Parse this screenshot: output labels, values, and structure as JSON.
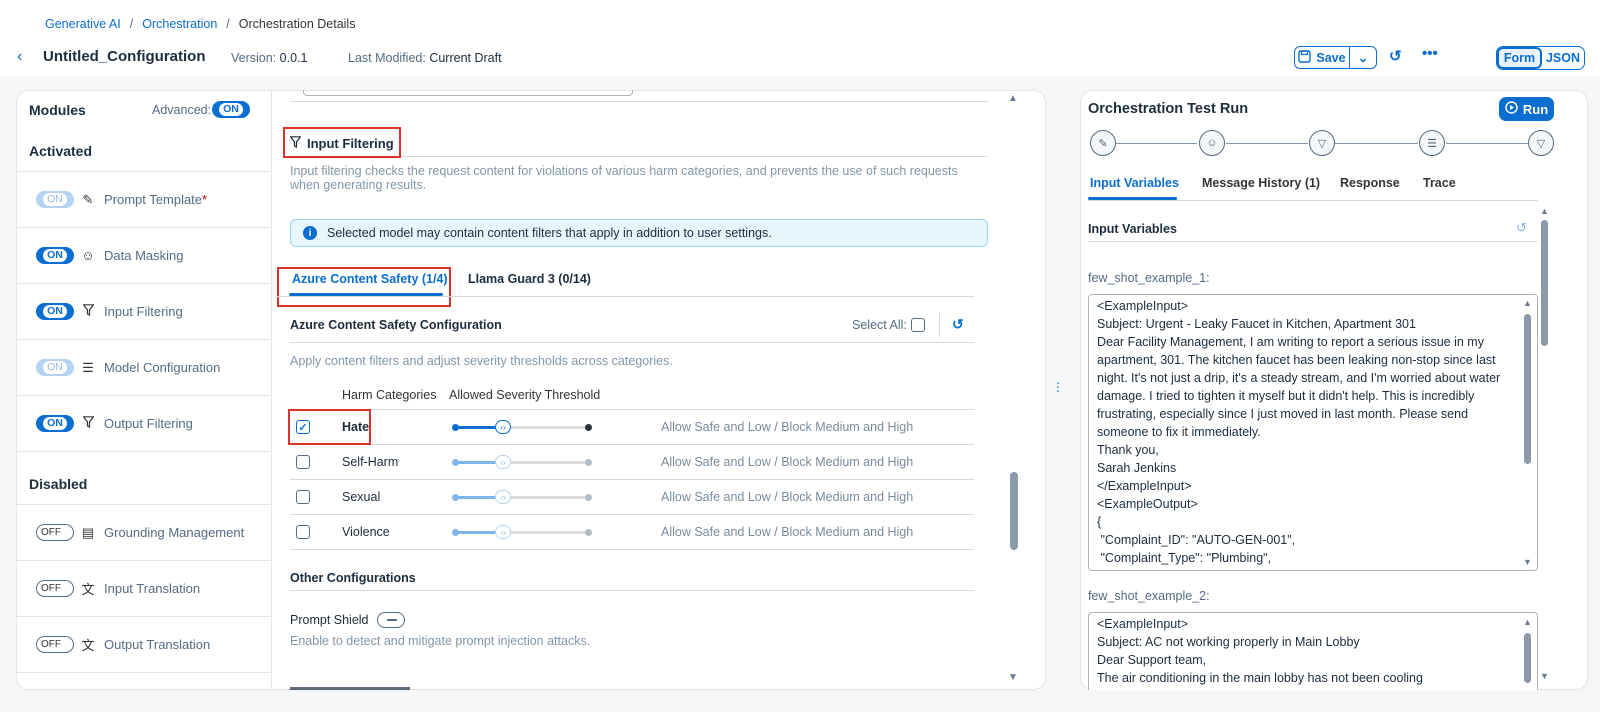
{
  "breadcrumb": [
    "Generative AI",
    "Orchestration",
    "Orchestration Details"
  ],
  "header": {
    "title": "Untitled_Configuration",
    "version_label": "Version:",
    "version": "0.0.1",
    "modified_label": "Last Modified:",
    "modified": "Current Draft",
    "save_label": "Save",
    "view_form": "Form",
    "view_json": "JSON"
  },
  "modules": {
    "title": "Modules",
    "advanced_label": "Advanced:",
    "advanced_toggle": "ON",
    "activated_heading": "Activated",
    "disabled_heading": "Disabled",
    "activated": [
      {
        "toggle": "ON",
        "label": "Prompt Template",
        "required": "*",
        "icon": "prompt-template-icon"
      },
      {
        "toggle": "ON",
        "label": "Data Masking",
        "icon": "mask-icon"
      },
      {
        "toggle": "ON",
        "label": "Input Filtering",
        "icon": "filter-icon"
      },
      {
        "toggle": "ON",
        "label": "Model Configuration",
        "icon": "sliders-icon"
      },
      {
        "toggle": "ON",
        "label": "Output Filtering",
        "icon": "filter-icon"
      }
    ],
    "disabled": [
      {
        "toggle": "OFF",
        "label": "Grounding Management",
        "icon": "grounding-icon"
      },
      {
        "toggle": "OFF",
        "label": "Input Translation",
        "icon": "translate-icon"
      },
      {
        "toggle": "OFF",
        "label": "Output Translation",
        "icon": "translate-icon"
      }
    ]
  },
  "input_filtering": {
    "title": "Input Filtering",
    "description": "Input filtering checks the request content for violations of various harm categories, and prevents the use of such requests when generating results.",
    "info": "Selected model may contain content filters that apply in addition to user settings.",
    "tabs": [
      "Azure Content Safety (1/4)",
      "Llama Guard 3 (0/14)"
    ],
    "config_heading": "Azure Content Safety Configuration",
    "select_all_label": "Select All:",
    "config_description": "Apply content filters and adjust severity thresholds across categories.",
    "col_categories": "Harm Categories",
    "col_threshold": "Allowed Severity Threshold",
    "rows": [
      {
        "name": "Hate",
        "checked": true,
        "threshold": "Allow Safe and Low / Block Medium and High"
      },
      {
        "name": "Self-Harm",
        "checked": false,
        "threshold": "Allow Safe and Low / Block Medium and High"
      },
      {
        "name": "Sexual",
        "checked": false,
        "threshold": "Allow Safe and Low / Block Medium and High"
      },
      {
        "name": "Violence",
        "checked": false,
        "threshold": "Allow Safe and Low / Block Medium and High"
      }
    ],
    "other_heading": "Other Configurations",
    "prompt_shield_label": "Prompt Shield",
    "prompt_shield_desc": "Enable to detect and mitigate prompt injection attacks."
  },
  "test_run": {
    "title": "Orchestration Test Run",
    "run_label": "Run",
    "tabs": [
      "Input Variables",
      "Message History (1)",
      "Response",
      "Trace"
    ],
    "section_title": "Input Variables",
    "example1_label": "few_shot_example_1:",
    "example1_text": "<ExampleInput>\nSubject: Urgent - Leaky Faucet in Kitchen, Apartment 301\nDear Facility Management, I am writing to report a serious issue in my apartment, 301. The kitchen faucet has been leaking non-stop since last night. It's not just a drip, it's a steady stream, and I'm worried about water damage. I tried to tighten it myself but it didn't help. This is incredibly\nfrustrating, especially since I just moved in last month. Please send someone to fix it immediately.\nThank you,\nSarah Jenkins\n</ExampleInput>\n<ExampleOutput>\n{\n \"Complaint_ID\": \"AUTO-GEN-001\",\n \"Complaint_Type\": \"Plumbing\",",
    "example2_label": "few_shot_example_2:",
    "example2_text": "<ExampleInput>\nSubject: AC not working properly in Main Lobby\nDear Support team,\nThe air conditioning in the main lobby has not been cooling"
  }
}
